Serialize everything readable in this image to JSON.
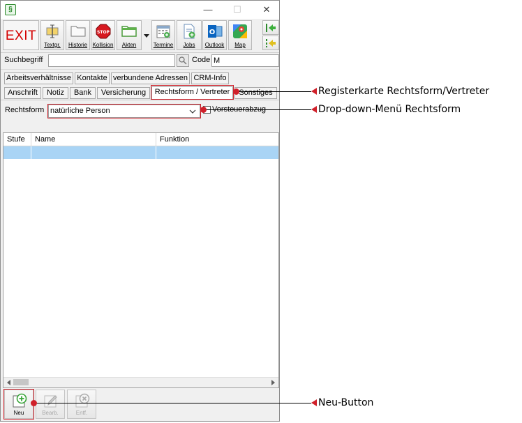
{
  "toolbar": {
    "exit_label": "EXIT",
    "buttons": [
      {
        "label": "Textgr.",
        "icon": "text-module-icon"
      },
      {
        "label": "Historie",
        "icon": "folder-icon"
      },
      {
        "label": "Kollision",
        "icon": "stop-icon"
      },
      {
        "label": "Akten",
        "icon": "folder-green-icon"
      },
      {
        "label": "Termine",
        "icon": "calendar-icon"
      },
      {
        "label": "Jobs",
        "icon": "jobs-icon"
      },
      {
        "label": "Outlook",
        "icon": "outlook-icon"
      },
      {
        "label": "Map",
        "icon": "map-icon"
      }
    ]
  },
  "search": {
    "label": "Suchbegriff",
    "value": "",
    "code_label": "Code",
    "code_value": "M"
  },
  "tabs_row1": [
    "Arbeitsverhältnisse",
    "Kontakte",
    "verbundene Adressen",
    "CRM-Info"
  ],
  "tabs_row2": [
    "Anschrift",
    "Notiz",
    "Bank",
    "Versicherung",
    "Rechtsform / Vertreter",
    "Sonstiges"
  ],
  "form": {
    "rechtsform_label": "Rechtsform",
    "rechtsform_value": "natürliche Person",
    "vorsteuer_label": "Vorsteuerabzug",
    "vorsteuer_checked": false
  },
  "grid": {
    "columns": [
      "Stufe",
      "Name",
      "Funktion"
    ]
  },
  "bottom_buttons": [
    {
      "label": "Neu",
      "enabled": true
    },
    {
      "label": "Bearb.",
      "enabled": false
    },
    {
      "label": "Entf.",
      "enabled": false
    }
  ],
  "annotations": {
    "tab_callout": "Registerkarte Rechtsform/Vertreter",
    "dropdown_callout": "Drop-down-Menü Rechtsform",
    "new_callout": "Neu-Button"
  },
  "colors": {
    "highlight": "#d0202a",
    "exit": "#d40000",
    "selected_row": "#a9d4f5"
  }
}
